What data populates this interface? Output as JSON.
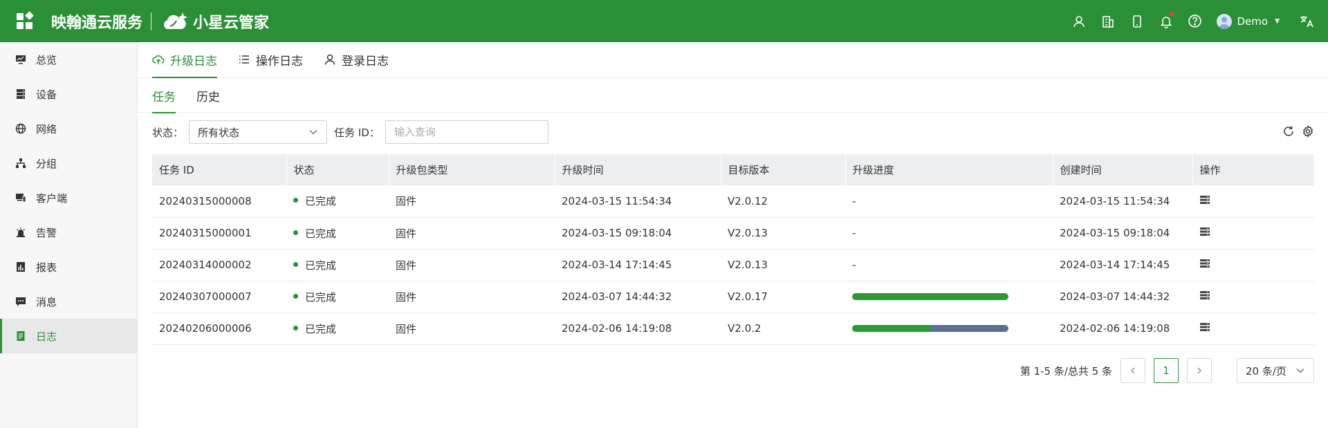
{
  "header": {
    "brand_left": "映翰通云服务",
    "brand_right": "小星云管家",
    "user_name": "Demo",
    "icons": [
      "user-icon",
      "building-icon",
      "mobile-icon",
      "bell-icon",
      "help-icon",
      "translate-icon"
    ],
    "bg_color": "#2a8f35"
  },
  "sidebar": {
    "items": [
      {
        "label": "总览",
        "icon": "monitor-icon"
      },
      {
        "label": "设备",
        "icon": "server-icon"
      },
      {
        "label": "网络",
        "icon": "globe-icon"
      },
      {
        "label": "分组",
        "icon": "hierarchy-icon"
      },
      {
        "label": "客户端",
        "icon": "devices-icon"
      },
      {
        "label": "告警",
        "icon": "alarm-icon"
      },
      {
        "label": "报表",
        "icon": "report-icon"
      },
      {
        "label": "消息",
        "icon": "message-icon"
      },
      {
        "label": "日志",
        "icon": "log-icon"
      }
    ],
    "active_index": 8
  },
  "tabs": {
    "primary": [
      "升级日志",
      "操作日志",
      "登录日志"
    ],
    "secondary": [
      "任务",
      "历史"
    ]
  },
  "filters": {
    "status_label": "状态：",
    "status_value": "所有状态",
    "task_id_label": "任务 ID：",
    "task_id_placeholder": "输入查询"
  },
  "table": {
    "columns": [
      "任务 ID",
      "状态",
      "升级包类型",
      "升级时间",
      "目标版本",
      "升级进度",
      "创建时间",
      "操作"
    ],
    "rows": [
      {
        "id": "20240315000008",
        "status": "已完成",
        "type": "固件",
        "upgrade_time": "2024-03-15 11:54:34",
        "version": "V2.0.12",
        "progress_text": "-",
        "progress": null,
        "created": "2024-03-15 11:54:34"
      },
      {
        "id": "20240315000001",
        "status": "已完成",
        "type": "固件",
        "upgrade_time": "2024-03-15 09:18:04",
        "version": "V2.0.13",
        "progress_text": "-",
        "progress": null,
        "created": "2024-03-15 09:18:04"
      },
      {
        "id": "20240314000002",
        "status": "已完成",
        "type": "固件",
        "upgrade_time": "2024-03-14 17:14:45",
        "version": "V2.0.13",
        "progress_text": "-",
        "progress": null,
        "created": "2024-03-14 17:14:45"
      },
      {
        "id": "20240307000007",
        "status": "已完成",
        "type": "固件",
        "upgrade_time": "2024-03-07 14:44:32",
        "version": "V2.0.17",
        "progress_text": "",
        "progress": 1.0,
        "created": "2024-03-07 14:44:32"
      },
      {
        "id": "20240206000006",
        "status": "已完成",
        "type": "固件",
        "upgrade_time": "2024-02-06 14:19:08",
        "version": "V2.0.2",
        "progress_text": "",
        "progress": 0.5,
        "created": "2024-02-06 14:19:08"
      }
    ]
  },
  "pagination": {
    "summary": "第 1-5 条/总共 5 条",
    "current_page": "1",
    "page_size": "20 条/页"
  }
}
